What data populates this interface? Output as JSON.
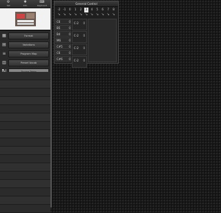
{
  "toolbar": {
    "buttons": [
      {
        "icon": "gear-icon",
        "glyph": "⚙",
        "label": "Set"
      },
      {
        "icon": "info-icon",
        "glyph": "✱",
        "label": "Info"
      },
      {
        "icon": "keyboard-icon",
        "glyph": "⌨",
        "label": "Keyboard"
      }
    ]
  },
  "sidebar": {
    "items": [
      {
        "label": "Format",
        "icon": "format-icon",
        "glyph": "▦"
      },
      {
        "label": "Variations",
        "icon": "variations-icon",
        "glyph": "▤"
      },
      {
        "label": "Program Map",
        "icon": "program-map-icon",
        "glyph": "≡"
      },
      {
        "label": "Preset Vocab",
        "icon": "preset-vocab-icon",
        "glyph": "▥"
      },
      {
        "label": "Tuning Table",
        "icon": "tuning-table-icon",
        "glyph": "ℕ",
        "active": true
      }
    ]
  },
  "panel": {
    "title": "General Control",
    "octaves": [
      "-2",
      "-1",
      "0",
      "1",
      "2",
      "3",
      "4",
      "5",
      "6",
      "7",
      "8"
    ],
    "active_octave": "3",
    "key_rows": [
      {
        "label": "C6",
        "value": "0"
      },
      {
        "label": "B5",
        "value": "0"
      },
      {
        "label": "B4",
        "value": "0"
      },
      {
        "label": "M6",
        "value": "0"
      },
      {
        "label": "C#5",
        "value": "0"
      },
      {
        "label": "C6",
        "value": "0"
      },
      {
        "label": "C#6",
        "value": "0"
      }
    ],
    "note_cells": [
      {
        "name": "C-2",
        "value": "0"
      },
      {
        "name": "C-2",
        "value": "0"
      },
      {
        "name": "C-2",
        "value": "0"
      },
      {
        "name": "C-2",
        "value": "0"
      }
    ]
  }
}
